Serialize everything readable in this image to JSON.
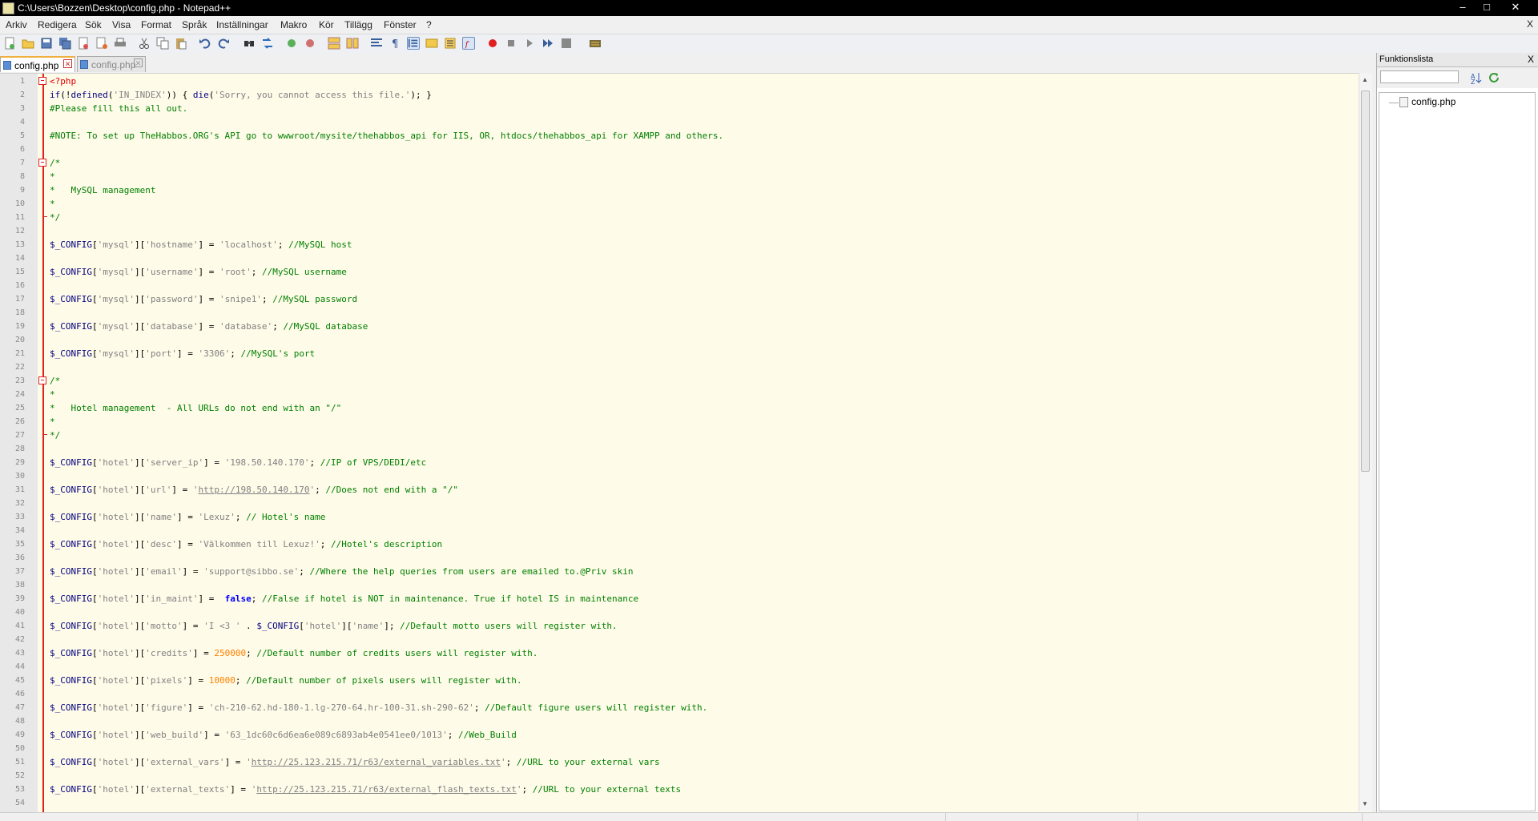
{
  "window": {
    "title": "C:\\Users\\Bozzen\\Desktop\\config.php - Notepad++",
    "minimize": "–",
    "maximize": "□",
    "close": "✕"
  },
  "menu": {
    "items": [
      "Arkiv",
      "Redigera",
      "Sök",
      "Visa",
      "Format",
      "Språk",
      "Inställningar",
      "Makro",
      "Kör",
      "Tillägg",
      "Fönster",
      "?"
    ],
    "close_doc": "X"
  },
  "toolbar": {
    "icons": [
      "new-file-icon",
      "open-file-icon",
      "save-icon",
      "save-all-icon",
      "close-icon",
      "close-all-icon",
      "print-icon",
      "cut-icon",
      "copy-icon",
      "paste-icon",
      "undo-icon",
      "redo-icon",
      "find-icon",
      "replace-icon",
      "zoom-in-icon",
      "zoom-out-icon",
      "sync-vertical-icon",
      "sync-horizontal-icon",
      "word-wrap-icon",
      "show-all-chars-icon",
      "indent-guide-icon",
      "user-language-icon",
      "doc-map-icon",
      "function-list-icon",
      "folder-workspace-icon",
      "record-macro-icon",
      "stop-macro-icon",
      "play-macro-icon",
      "run-macro-multiple-icon",
      "save-macro-icon",
      "shortcut-mapper-icon"
    ]
  },
  "tabs": [
    {
      "label": "config.php",
      "active": true
    },
    {
      "label": "config.php",
      "active": false
    }
  ],
  "editor": {
    "lines": [
      [
        [
          "tag",
          "<?php"
        ]
      ],
      [
        [
          "kw2",
          "if"
        ],
        [
          "txt",
          "(!"
        ],
        [
          "fn",
          "defined"
        ],
        [
          "txt",
          "("
        ],
        [
          "str",
          "'IN_INDEX'"
        ],
        [
          "txt",
          ")) { "
        ],
        [
          "fn",
          "die"
        ],
        [
          "txt",
          "("
        ],
        [
          "str",
          "'Sorry, you cannot access this file.'"
        ],
        [
          "txt",
          "); }"
        ]
      ],
      [
        [
          "cmt",
          "#Please fill this all out."
        ]
      ],
      [],
      [
        [
          "cmt",
          "#NOTE: To set up TheHabbos.ORG's API go to wwwroot/mysite/thehabbos_api for IIS, OR, htdocs/thehabbos_api for XAMPP and others."
        ]
      ],
      [],
      [
        [
          "cmt",
          "/*"
        ]
      ],
      [
        [
          "cmt",
          "*"
        ]
      ],
      [
        [
          "cmt",
          "*   MySQL management"
        ]
      ],
      [
        [
          "cmt",
          "*"
        ]
      ],
      [
        [
          "cmt",
          "*/"
        ]
      ],
      [],
      [
        [
          "var",
          "$_CONFIG"
        ],
        [
          "txt",
          "["
        ],
        [
          "str",
          "'mysql'"
        ],
        [
          "txt",
          "]["
        ],
        [
          "str",
          "'hostname'"
        ],
        [
          "txt",
          "] = "
        ],
        [
          "str",
          "'localhost'"
        ],
        [
          "txt",
          "; "
        ],
        [
          "cmt",
          "//MySQL host"
        ]
      ],
      [],
      [
        [
          "var",
          "$_CONFIG"
        ],
        [
          "txt",
          "["
        ],
        [
          "str",
          "'mysql'"
        ],
        [
          "txt",
          "]["
        ],
        [
          "str",
          "'username'"
        ],
        [
          "txt",
          "] = "
        ],
        [
          "str",
          "'root'"
        ],
        [
          "txt",
          "; "
        ],
        [
          "cmt",
          "//MySQL username"
        ]
      ],
      [],
      [
        [
          "var",
          "$_CONFIG"
        ],
        [
          "txt",
          "["
        ],
        [
          "str",
          "'mysql'"
        ],
        [
          "txt",
          "]["
        ],
        [
          "str",
          "'password'"
        ],
        [
          "txt",
          "] = "
        ],
        [
          "str",
          "'snipe1'"
        ],
        [
          "txt",
          "; "
        ],
        [
          "cmt",
          "//MySQL password"
        ]
      ],
      [],
      [
        [
          "var",
          "$_CONFIG"
        ],
        [
          "txt",
          "["
        ],
        [
          "str",
          "'mysql'"
        ],
        [
          "txt",
          "]["
        ],
        [
          "str",
          "'database'"
        ],
        [
          "txt",
          "] = "
        ],
        [
          "str",
          "'database'"
        ],
        [
          "txt",
          "; "
        ],
        [
          "cmt",
          "//MySQL database"
        ]
      ],
      [],
      [
        [
          "var",
          "$_CONFIG"
        ],
        [
          "txt",
          "["
        ],
        [
          "str",
          "'mysql'"
        ],
        [
          "txt",
          "]["
        ],
        [
          "str",
          "'port'"
        ],
        [
          "txt",
          "] = "
        ],
        [
          "str",
          "'3306'"
        ],
        [
          "txt",
          "; "
        ],
        [
          "cmt",
          "//MySQL's port"
        ]
      ],
      [],
      [
        [
          "cmt",
          "/*"
        ]
      ],
      [
        [
          "cmt",
          "*"
        ]
      ],
      [
        [
          "cmt",
          "*   Hotel management  - All URLs do not end with an \"/\""
        ]
      ],
      [
        [
          "cmt",
          "*"
        ]
      ],
      [
        [
          "cmt",
          "*/"
        ]
      ],
      [],
      [
        [
          "var",
          "$_CONFIG"
        ],
        [
          "txt",
          "["
        ],
        [
          "str",
          "'hotel'"
        ],
        [
          "txt",
          "]["
        ],
        [
          "str",
          "'server_ip'"
        ],
        [
          "txt",
          "] = "
        ],
        [
          "str",
          "'198.50.140.170'"
        ],
        [
          "txt",
          "; "
        ],
        [
          "cmt",
          "//IP of VPS/DEDI/etc"
        ]
      ],
      [],
      [
        [
          "var",
          "$_CONFIG"
        ],
        [
          "txt",
          "["
        ],
        [
          "str",
          "'hotel'"
        ],
        [
          "txt",
          "]["
        ],
        [
          "str",
          "'url'"
        ],
        [
          "txt",
          "] = "
        ],
        [
          "str",
          "'"
        ],
        [
          "url",
          "http://198.50.140.170"
        ],
        [
          "str",
          "'"
        ],
        [
          "txt",
          "; "
        ],
        [
          "cmt",
          "//Does not end with a \"/\""
        ]
      ],
      [],
      [
        [
          "var",
          "$_CONFIG"
        ],
        [
          "txt",
          "["
        ],
        [
          "str",
          "'hotel'"
        ],
        [
          "txt",
          "]["
        ],
        [
          "str",
          "'name'"
        ],
        [
          "txt",
          "] = "
        ],
        [
          "str",
          "'Lexuz'"
        ],
        [
          "txt",
          "; "
        ],
        [
          "cmt",
          "// Hotel's name"
        ]
      ],
      [],
      [
        [
          "var",
          "$_CONFIG"
        ],
        [
          "txt",
          "["
        ],
        [
          "str",
          "'hotel'"
        ],
        [
          "txt",
          "]["
        ],
        [
          "str",
          "'desc'"
        ],
        [
          "txt",
          "] = "
        ],
        [
          "str",
          "'Välkommen till Lexuz!'"
        ],
        [
          "txt",
          "; "
        ],
        [
          "cmt",
          "//Hotel's description"
        ]
      ],
      [],
      [
        [
          "var",
          "$_CONFIG"
        ],
        [
          "txt",
          "["
        ],
        [
          "str",
          "'hotel'"
        ],
        [
          "txt",
          "]["
        ],
        [
          "str",
          "'email'"
        ],
        [
          "txt",
          "] = "
        ],
        [
          "str",
          "'support@sibbo.se'"
        ],
        [
          "txt",
          "; "
        ],
        [
          "cmt",
          "//Where the help queries from users are emailed to.@Priv skin"
        ]
      ],
      [],
      [
        [
          "var",
          "$_CONFIG"
        ],
        [
          "txt",
          "["
        ],
        [
          "str",
          "'hotel'"
        ],
        [
          "txt",
          "]["
        ],
        [
          "str",
          "'in_maint'"
        ],
        [
          "txt",
          "] =  "
        ],
        [
          "kw",
          "false"
        ],
        [
          "txt",
          "; "
        ],
        [
          "cmt",
          "//False if hotel is NOT in maintenance. True if hotel IS in maintenance"
        ]
      ],
      [],
      [
        [
          "var",
          "$_CONFIG"
        ],
        [
          "txt",
          "["
        ],
        [
          "str",
          "'hotel'"
        ],
        [
          "txt",
          "]["
        ],
        [
          "str",
          "'motto'"
        ],
        [
          "txt",
          "] = "
        ],
        [
          "str",
          "'I <3 '"
        ],
        [
          "txt",
          " . "
        ],
        [
          "var",
          "$_CONFIG"
        ],
        [
          "txt",
          "["
        ],
        [
          "str",
          "'hotel'"
        ],
        [
          "txt",
          "]["
        ],
        [
          "str",
          "'name'"
        ],
        [
          "txt",
          "]; "
        ],
        [
          "cmt",
          "//Default motto users will register with."
        ]
      ],
      [],
      [
        [
          "var",
          "$_CONFIG"
        ],
        [
          "txt",
          "["
        ],
        [
          "str",
          "'hotel'"
        ],
        [
          "txt",
          "]["
        ],
        [
          "str",
          "'credits'"
        ],
        [
          "txt",
          "] = "
        ],
        [
          "num",
          "250000"
        ],
        [
          "txt",
          "; "
        ],
        [
          "cmt",
          "//Default number of credits users will register with."
        ]
      ],
      [],
      [
        [
          "var",
          "$_CONFIG"
        ],
        [
          "txt",
          "["
        ],
        [
          "str",
          "'hotel'"
        ],
        [
          "txt",
          "]["
        ],
        [
          "str",
          "'pixels'"
        ],
        [
          "txt",
          "] = "
        ],
        [
          "num",
          "10000"
        ],
        [
          "txt",
          "; "
        ],
        [
          "cmt",
          "//Default number of pixels users will register with."
        ]
      ],
      [],
      [
        [
          "var",
          "$_CONFIG"
        ],
        [
          "txt",
          "["
        ],
        [
          "str",
          "'hotel'"
        ],
        [
          "txt",
          "]["
        ],
        [
          "str",
          "'figure'"
        ],
        [
          "txt",
          "] = "
        ],
        [
          "str",
          "'ch-210-62.hd-180-1.lg-270-64.hr-100-31.sh-290-62'"
        ],
        [
          "txt",
          "; "
        ],
        [
          "cmt",
          "//Default figure users will register with."
        ]
      ],
      [],
      [
        [
          "var",
          "$_CONFIG"
        ],
        [
          "txt",
          "["
        ],
        [
          "str",
          "'hotel'"
        ],
        [
          "txt",
          "]["
        ],
        [
          "str",
          "'web_build'"
        ],
        [
          "txt",
          "] = "
        ],
        [
          "str",
          "'63_1dc60c6d6ea6e089c6893ab4e0541ee0/1013'"
        ],
        [
          "txt",
          "; "
        ],
        [
          "cmt",
          "//Web_Build"
        ]
      ],
      [],
      [
        [
          "var",
          "$_CONFIG"
        ],
        [
          "txt",
          "["
        ],
        [
          "str",
          "'hotel'"
        ],
        [
          "txt",
          "]["
        ],
        [
          "str",
          "'external_vars'"
        ],
        [
          "txt",
          "] = "
        ],
        [
          "str",
          "'"
        ],
        [
          "url",
          "http://25.123.215.71/r63/external_variables.txt"
        ],
        [
          "str",
          "'"
        ],
        [
          "txt",
          "; "
        ],
        [
          "cmt",
          "//URL to your external vars"
        ]
      ],
      [],
      [
        [
          "var",
          "$_CONFIG"
        ],
        [
          "txt",
          "["
        ],
        [
          "str",
          "'hotel'"
        ],
        [
          "txt",
          "]["
        ],
        [
          "str",
          "'external_texts'"
        ],
        [
          "txt",
          "] = "
        ],
        [
          "str",
          "'"
        ],
        [
          "url",
          "http://25.123.215.71/r63/external_flash_texts.txt"
        ],
        [
          "str",
          "'"
        ],
        [
          "txt",
          "; "
        ],
        [
          "cmt",
          "//URL to your external texts"
        ]
      ],
      []
    ]
  },
  "function_list": {
    "title": "Funktionslista",
    "close": "X",
    "search_value": "",
    "tree_item": "config.php"
  }
}
